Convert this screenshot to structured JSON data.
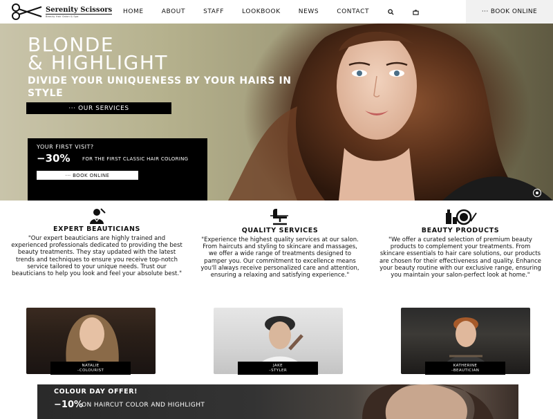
{
  "brand": {
    "name": "Serenity Scissors",
    "tagline": "Beauty Hair Salon & Spa"
  },
  "nav": {
    "items": [
      "HOME",
      "ABOUT",
      "STAFF",
      "LOOKBOOK",
      "NEWS",
      "CONTACT"
    ],
    "book_label": "··· BOOK ONLINE",
    "icons": [
      "search-icon",
      "shopping-bag-icon"
    ]
  },
  "hero": {
    "title_line1": "BLONDE",
    "title_line2": "& HIGHLIGHT",
    "subtitle": "DIVIDE YOUR UNIQUENESS BY YOUR HAIRS IN STYLE",
    "cta_label": "··· OUR SERVICES",
    "promo": {
      "question": "YOUR FIRST VISIT?",
      "discount": "−30%",
      "description": "FOR THE FIRST CLASSIC HAIR COLORING",
      "cta_label": "··· BOOK ONLINE"
    }
  },
  "features": [
    {
      "icon": "beautician-icon",
      "title": "EXPERT BEAUTICIANS",
      "text": "\"Our expert beauticians are highly trained and experienced professionals dedicated to providing the best beauty treatments. They stay updated with the latest trends and techniques to ensure you receive top-notch service tailored to your unique needs. Trust our beauticians to help you look and feel your absolute best.\""
    },
    {
      "icon": "salon-chair-icon",
      "title": "QUALITY SERVICES",
      "text": "\"Experience the highest quality services at our salon. From haircuts and styling to skincare and massages, we offer a wide range of treatments designed to pamper you. Our commitment to excellence means you'll always receive personalized care and attention, ensuring a relaxing and satisfying experience.\""
    },
    {
      "icon": "beauty-products-icon",
      "title": "BEAUTY PRODUCTS",
      "text": "\"We offer a curated selection of premium beauty products to complement your treatments. From skincare essentials to hair care solutions, our products are chosen for their effectiveness and quality. Enhance your beauty routine with our exclusive range, ensuring you maintain your salon-perfect look at home.\""
    }
  ],
  "staff": [
    {
      "name": "NATALIE",
      "role": "–COLOURIST"
    },
    {
      "name": "JAKE",
      "role": "–STYLER"
    },
    {
      "name": "KATHERINE",
      "role": "–BEAUTICIAN"
    }
  ],
  "colour_day": {
    "title": "COLOUR DAY OFFER!",
    "discount": "−10%",
    "description": "ON HAIRCUT COLOR AND HIGHLIGHT"
  }
}
